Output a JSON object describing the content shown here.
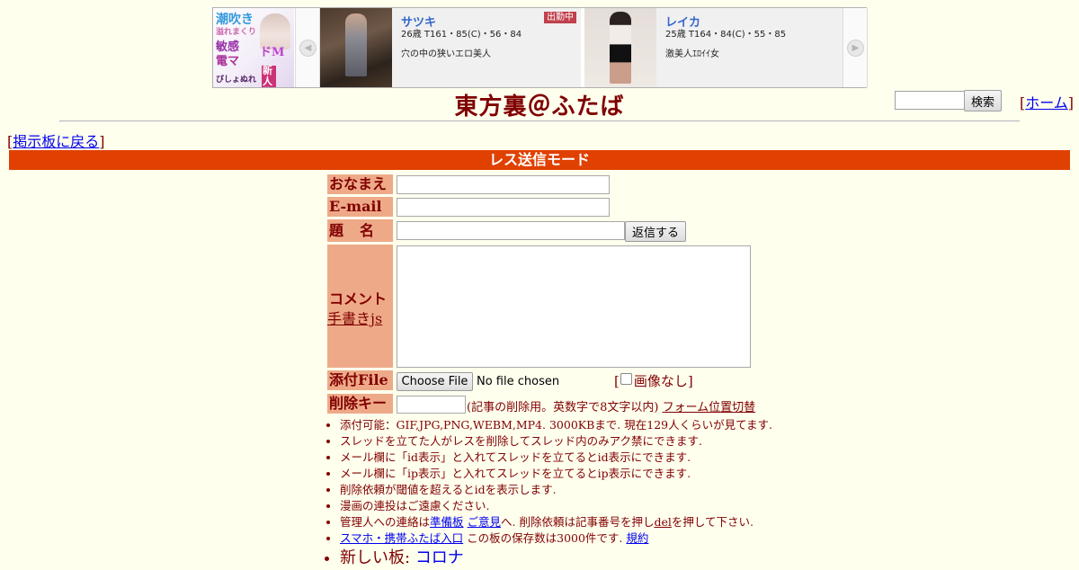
{
  "ad": {
    "promo": {
      "line1": "潮吹き",
      "line2": "溢れまくり",
      "line3": "敏感",
      "line4": "電マ",
      "line5": "ドM",
      "line6": "新人秘書",
      "line7": "びしょぬれ"
    },
    "prev_arrow": "◀",
    "next_arrow": "▶",
    "cards": [
      {
        "name": "サツキ",
        "stats": "26歳 T161・85(C)・56・84",
        "desc": "穴の中の狭いエロ美人",
        "badge": "出勤中"
      },
      {
        "name": "レイカ",
        "stats": "25歳 T164・84(C)・55・85",
        "desc": "激美人ｴﾛｲｲ女"
      }
    ]
  },
  "header": {
    "title": "東方裏＠ふたば",
    "search_placeholder": "",
    "search_button": "検索",
    "home_link": "ホーム",
    "back_link": "掲示板に戻る"
  },
  "mode_bar": "レス送信モード",
  "form": {
    "labels": {
      "name": "おなまえ",
      "email": "E-mail",
      "subject": "題名",
      "comment": "コメント",
      "handwrite": "手書きjs",
      "file": "添付File",
      "delkey": "削除キー"
    },
    "values": {
      "name": "",
      "email": "",
      "subject": "",
      "comment": "",
      "delkey": ""
    },
    "reply_button": "返信する",
    "file_button": "Choose File",
    "file_status": "No file chosen",
    "no_image": "画像なし",
    "delkey_note": "(記事の削除用。英数字で8文字以内)",
    "form_toggle": "フォーム位置切替"
  },
  "notes": {
    "n1": "添付可能：GIF,JPG,PNG,WEBM,MP4. 3000KBまで. 現在129人くらいが見てます.",
    "n2": "スレッドを立てた人がレスを削除してスレッド内のみアク禁にできます.",
    "n3": "メール欄に「id表示」と入れてスレッドを立てるとid表示にできます.",
    "n4": "メール欄に「ip表示」と入れてスレッドを立てるとip表示にできます.",
    "n5": "削除依頼が閾値を超えるとidを表示します.",
    "n6": "漫画の連投はご遠慮ください.",
    "n7_pre": "管理人への連絡は",
    "n7_link1": "準備板",
    "n7_link2": "ご意見",
    "n7_mid": "へ. 削除依頼は記事番号を押し",
    "n7_link3": "del",
    "n7_post": "を押して下さい.",
    "n8_link": "スマホ・携帯ふたば入口",
    "n8_mid": "この板の保存数は3000件です.",
    "n8_link2": "規約",
    "n9_pre": "新しい板:",
    "n9_link": "コロナ"
  }
}
